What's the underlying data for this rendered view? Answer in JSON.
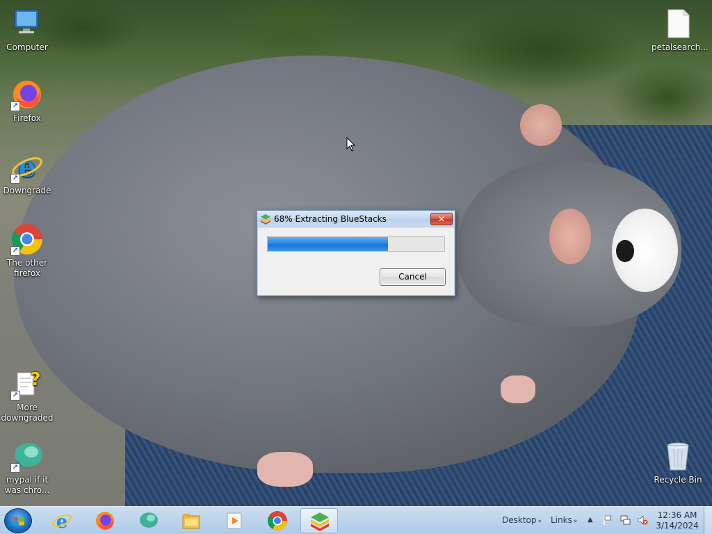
{
  "desktop": {
    "icons": [
      {
        "label": "Computer",
        "icon": "computer-icon"
      },
      {
        "label": "Firefox",
        "icon": "firefox-icon"
      },
      {
        "label": "Downgrade",
        "icon": "internet-explorer-icon"
      },
      {
        "label": "The other firefox",
        "icon": "chrome-icon"
      },
      {
        "label": "More downgraded",
        "icon": "help-file-icon"
      },
      {
        "label": "mypal if it was chro...",
        "icon": "mypal-icon"
      },
      {
        "label": "petalsearch...",
        "icon": "blank-file-icon"
      },
      {
        "label": "Recycle Bin",
        "icon": "recycle-bin-icon"
      }
    ]
  },
  "dialog": {
    "title": "68% Extracting BlueStacks",
    "close_label": "✕",
    "progress_fraction": 0.68,
    "cancel_label": "Cancel",
    "icon": "bluestacks-icon"
  },
  "taskbar": {
    "start_icon": "windows-start-icon",
    "pinned": [
      {
        "icon": "internet-explorer-icon"
      },
      {
        "icon": "firefox-icon"
      },
      {
        "icon": "mypal-icon"
      },
      {
        "icon": "file-explorer-icon"
      },
      {
        "icon": "media-player-icon"
      },
      {
        "icon": "chrome-icon"
      },
      {
        "icon": "bluestacks-icon",
        "active": true
      }
    ],
    "toolbars": [
      {
        "label": "Desktop"
      },
      {
        "label": "Links"
      }
    ],
    "tray_icons": [
      "flag-icon",
      "network-icon",
      "volume-muted-icon"
    ],
    "clock": {
      "time": "12:36 AM",
      "date": "3/14/2024"
    }
  }
}
